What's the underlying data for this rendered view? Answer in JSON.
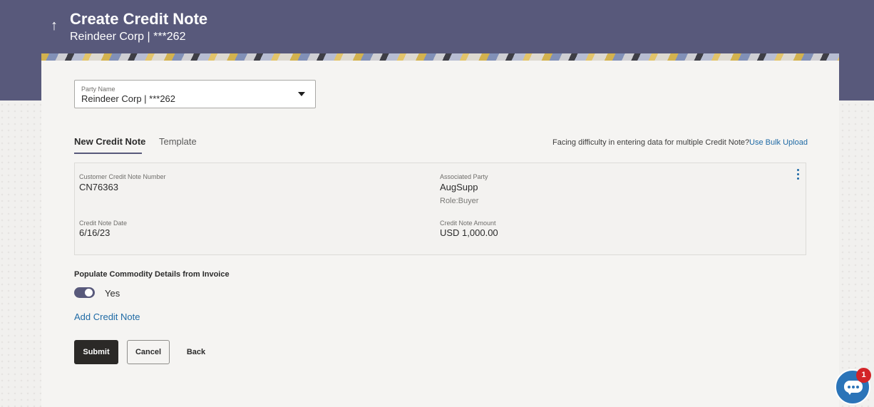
{
  "header": {
    "title": "Create Credit Note",
    "subtitle": "Reindeer Corp | ***262",
    "back_icon": "arrow-up-icon"
  },
  "party": {
    "label": "Party Name",
    "value": "Reindeer Corp | ***262"
  },
  "tabs": [
    {
      "label": "New Credit Note",
      "active": true
    },
    {
      "label": "Template",
      "active": false
    }
  ],
  "bulk_upload": {
    "text": "Facing difficulty in entering data for multiple Credit Note?",
    "link": "Use Bulk Upload"
  },
  "credit_note": {
    "number_label": "Customer Credit Note Number",
    "number_value": "CN76363",
    "party_label": "Associated Party",
    "party_value": "AugSupp",
    "role": "Role:Buyer",
    "date_label": "Credit Note Date",
    "date_value": "6/16/23",
    "amount_label": "Credit Note Amount",
    "amount_value": "USD 1,000.00"
  },
  "populate": {
    "label": "Populate Commodity Details from Invoice",
    "toggle_text": "Yes",
    "enabled": true
  },
  "actions": {
    "add_link": "Add Credit Note",
    "submit": "Submit",
    "cancel": "Cancel",
    "back": "Back"
  },
  "chat": {
    "badge_count": "1"
  },
  "colors": {
    "header_bg": "#58597b",
    "link": "#1f6aa5",
    "primary_button": "#2b2927",
    "chat": "#2b74b8",
    "badge": "#d32327"
  }
}
